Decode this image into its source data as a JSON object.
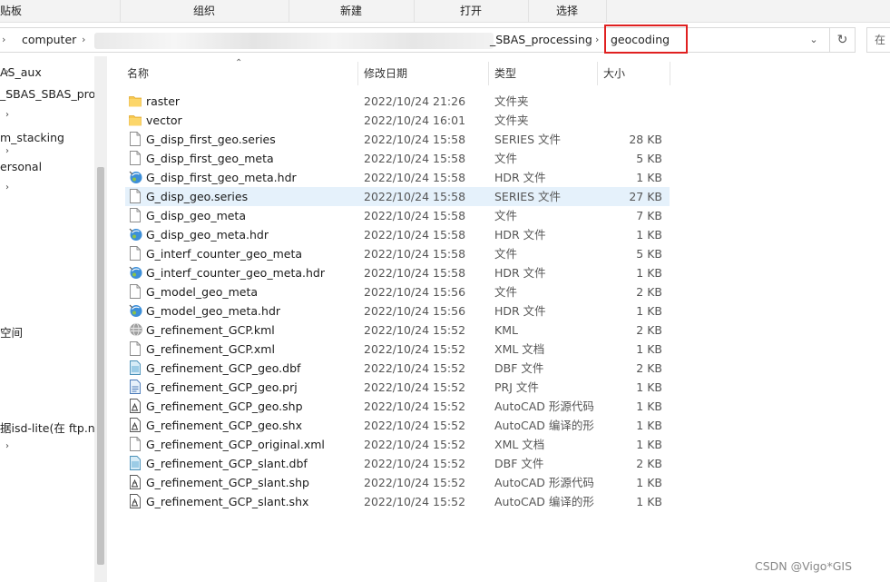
{
  "ribbon": {
    "groups": [
      "贴板",
      "组织",
      "新建",
      "打开",
      "选择"
    ]
  },
  "address": {
    "crumbs": [
      "computer",
      "_SBAS_processing",
      "geocoding"
    ],
    "search_label": "在"
  },
  "nav": {
    "items": [
      "AS_aux",
      "_SBAS_SBAS_proce",
      "m_stacking",
      "ersonal",
      "空间",
      "据isd-lite(在 ftp.nc"
    ]
  },
  "columns": {
    "name": "名称",
    "date": "修改日期",
    "type": "类型",
    "size": "大小"
  },
  "files": [
    {
      "name": "raster",
      "date": "2022/10/24 21:26",
      "type": "文件夹",
      "size": "",
      "icon": "folder-icon"
    },
    {
      "name": "vector",
      "date": "2022/10/24 16:01",
      "type": "文件夹",
      "size": "",
      "icon": "folder-icon"
    },
    {
      "name": "G_disp_first_geo.series",
      "date": "2022/10/24 15:58",
      "type": "SERIES 文件",
      "size": "28 KB",
      "icon": "file-icon"
    },
    {
      "name": "G_disp_first_geo_meta",
      "date": "2022/10/24 15:58",
      "type": "文件",
      "size": "5 KB",
      "icon": "file-icon"
    },
    {
      "name": "G_disp_first_geo_meta.hdr",
      "date": "2022/10/24 15:58",
      "type": "HDR 文件",
      "size": "1 KB",
      "icon": "hdr-icon"
    },
    {
      "name": "G_disp_geo.series",
      "date": "2022/10/24 15:58",
      "type": "SERIES 文件",
      "size": "27 KB",
      "icon": "file-icon",
      "selected": true
    },
    {
      "name": "G_disp_geo_meta",
      "date": "2022/10/24 15:58",
      "type": "文件",
      "size": "7 KB",
      "icon": "file-icon"
    },
    {
      "name": "G_disp_geo_meta.hdr",
      "date": "2022/10/24 15:58",
      "type": "HDR 文件",
      "size": "1 KB",
      "icon": "hdr-icon"
    },
    {
      "name": "G_interf_counter_geo_meta",
      "date": "2022/10/24 15:58",
      "type": "文件",
      "size": "5 KB",
      "icon": "file-icon"
    },
    {
      "name": "G_interf_counter_geo_meta.hdr",
      "date": "2022/10/24 15:58",
      "type": "HDR 文件",
      "size": "1 KB",
      "icon": "hdr-icon"
    },
    {
      "name": "G_model_geo_meta",
      "date": "2022/10/24 15:56",
      "type": "文件",
      "size": "2 KB",
      "icon": "file-icon"
    },
    {
      "name": "G_model_geo_meta.hdr",
      "date": "2022/10/24 15:56",
      "type": "HDR 文件",
      "size": "1 KB",
      "icon": "hdr-icon"
    },
    {
      "name": "G_refinement_GCP.kml",
      "date": "2022/10/24 15:52",
      "type": "KML",
      "size": "2 KB",
      "icon": "kml-icon"
    },
    {
      "name": "G_refinement_GCP.xml",
      "date": "2022/10/24 15:52",
      "type": "XML 文档",
      "size": "1 KB",
      "icon": "file-icon"
    },
    {
      "name": "G_refinement_GCP_geo.dbf",
      "date": "2022/10/24 15:52",
      "type": "DBF 文件",
      "size": "2 KB",
      "icon": "dbf-icon"
    },
    {
      "name": "G_refinement_GCP_geo.prj",
      "date": "2022/10/24 15:52",
      "type": "PRJ 文件",
      "size": "1 KB",
      "icon": "prj-icon"
    },
    {
      "name": "G_refinement_GCP_geo.shp",
      "date": "2022/10/24 15:52",
      "type": "AutoCAD 形源代码",
      "size": "1 KB",
      "icon": "shp-icon"
    },
    {
      "name": "G_refinement_GCP_geo.shx",
      "date": "2022/10/24 15:52",
      "type": "AutoCAD 编译的形",
      "size": "1 KB",
      "icon": "shp-icon"
    },
    {
      "name": "G_refinement_GCP_original.xml",
      "date": "2022/10/24 15:52",
      "type": "XML 文档",
      "size": "1 KB",
      "icon": "file-icon"
    },
    {
      "name": "G_refinement_GCP_slant.dbf",
      "date": "2022/10/24 15:52",
      "type": "DBF 文件",
      "size": "2 KB",
      "icon": "dbf-icon"
    },
    {
      "name": "G_refinement_GCP_slant.shp",
      "date": "2022/10/24 15:52",
      "type": "AutoCAD 形源代码",
      "size": "1 KB",
      "icon": "shp-icon"
    },
    {
      "name": "G_refinement_GCP_slant.shx",
      "date": "2022/10/24 15:52",
      "type": "AutoCAD 编译的形",
      "size": "1 KB",
      "icon": "shp-icon"
    }
  ],
  "watermark": "CSDN @Vigo*GIS",
  "colors": {
    "highlight_box": "#e02020",
    "selected_row": "#e5f1fb",
    "folder": "#f7c84f"
  }
}
